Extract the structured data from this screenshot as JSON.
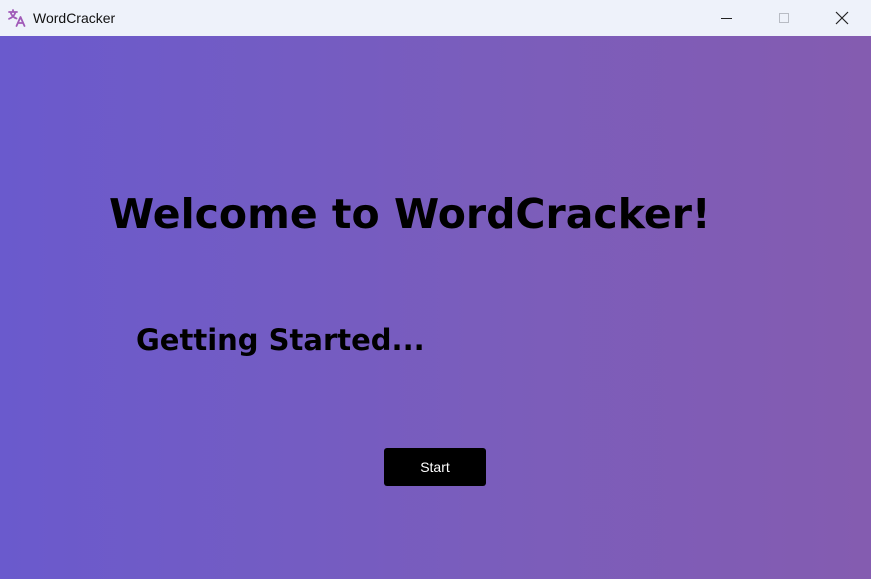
{
  "window": {
    "title": "WordCracker",
    "icon": "translate-icon",
    "controls": {
      "minimize_icon": "minimize-icon",
      "maximize_icon": "maximize-icon",
      "close_icon": "close-icon"
    }
  },
  "main": {
    "heading": "Welcome to WordCracker!",
    "subtitle": "Getting Started...",
    "start_label": "Start"
  },
  "colors": {
    "background_start": "#6a5acd",
    "background_end": "#845cb0",
    "titlebar": "#eef2fa",
    "button": "#000000",
    "icon_accent": "#9b59b6"
  }
}
